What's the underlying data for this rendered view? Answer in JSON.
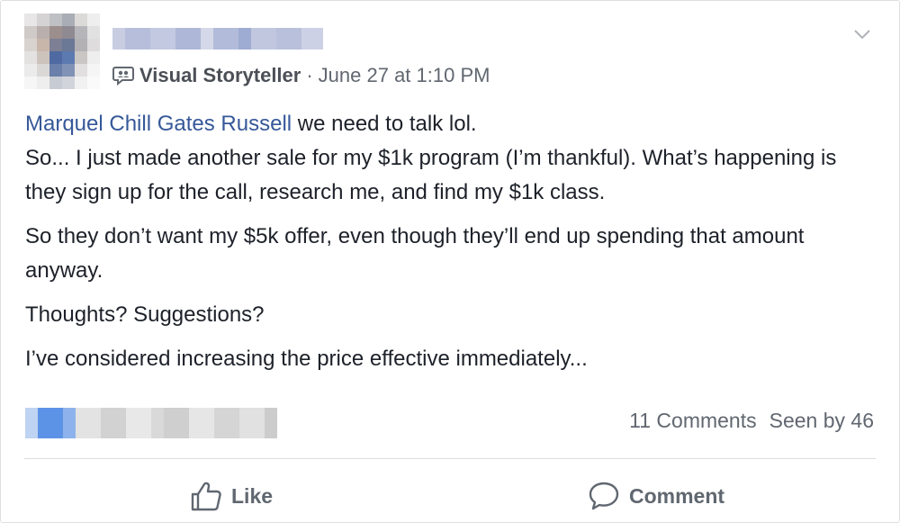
{
  "post": {
    "group_name": "Visual Storyteller",
    "separator": "·",
    "timestamp": "June 27 at 1:10 PM",
    "mention": "Marquel Chill Gates Russell",
    "line1_rest": " we need to talk lol.",
    "line1_cont": "So... I just made another sale for my $1k program (I’m thankful). What’s happening is they sign up for the call, research me, and find my $1k class.",
    "para2": "So they don’t want my $5k offer, even though they’ll end up spending that amount anyway.",
    "para3": "Thoughts? Suggestions?",
    "para4": "I’ve considered increasing the price effective immediately..."
  },
  "stats": {
    "comments": "11 Comments",
    "seen": "Seen by 46"
  },
  "actions": {
    "like": "Like",
    "comment": "Comment"
  },
  "icons": {
    "group": "group-speech-icon",
    "chevron": "chevron-down-icon",
    "like": "thumbs-up-icon",
    "comment": "speech-bubble-icon"
  },
  "colors": {
    "link": "#365899",
    "text": "#1d2129",
    "meta": "#616770"
  }
}
